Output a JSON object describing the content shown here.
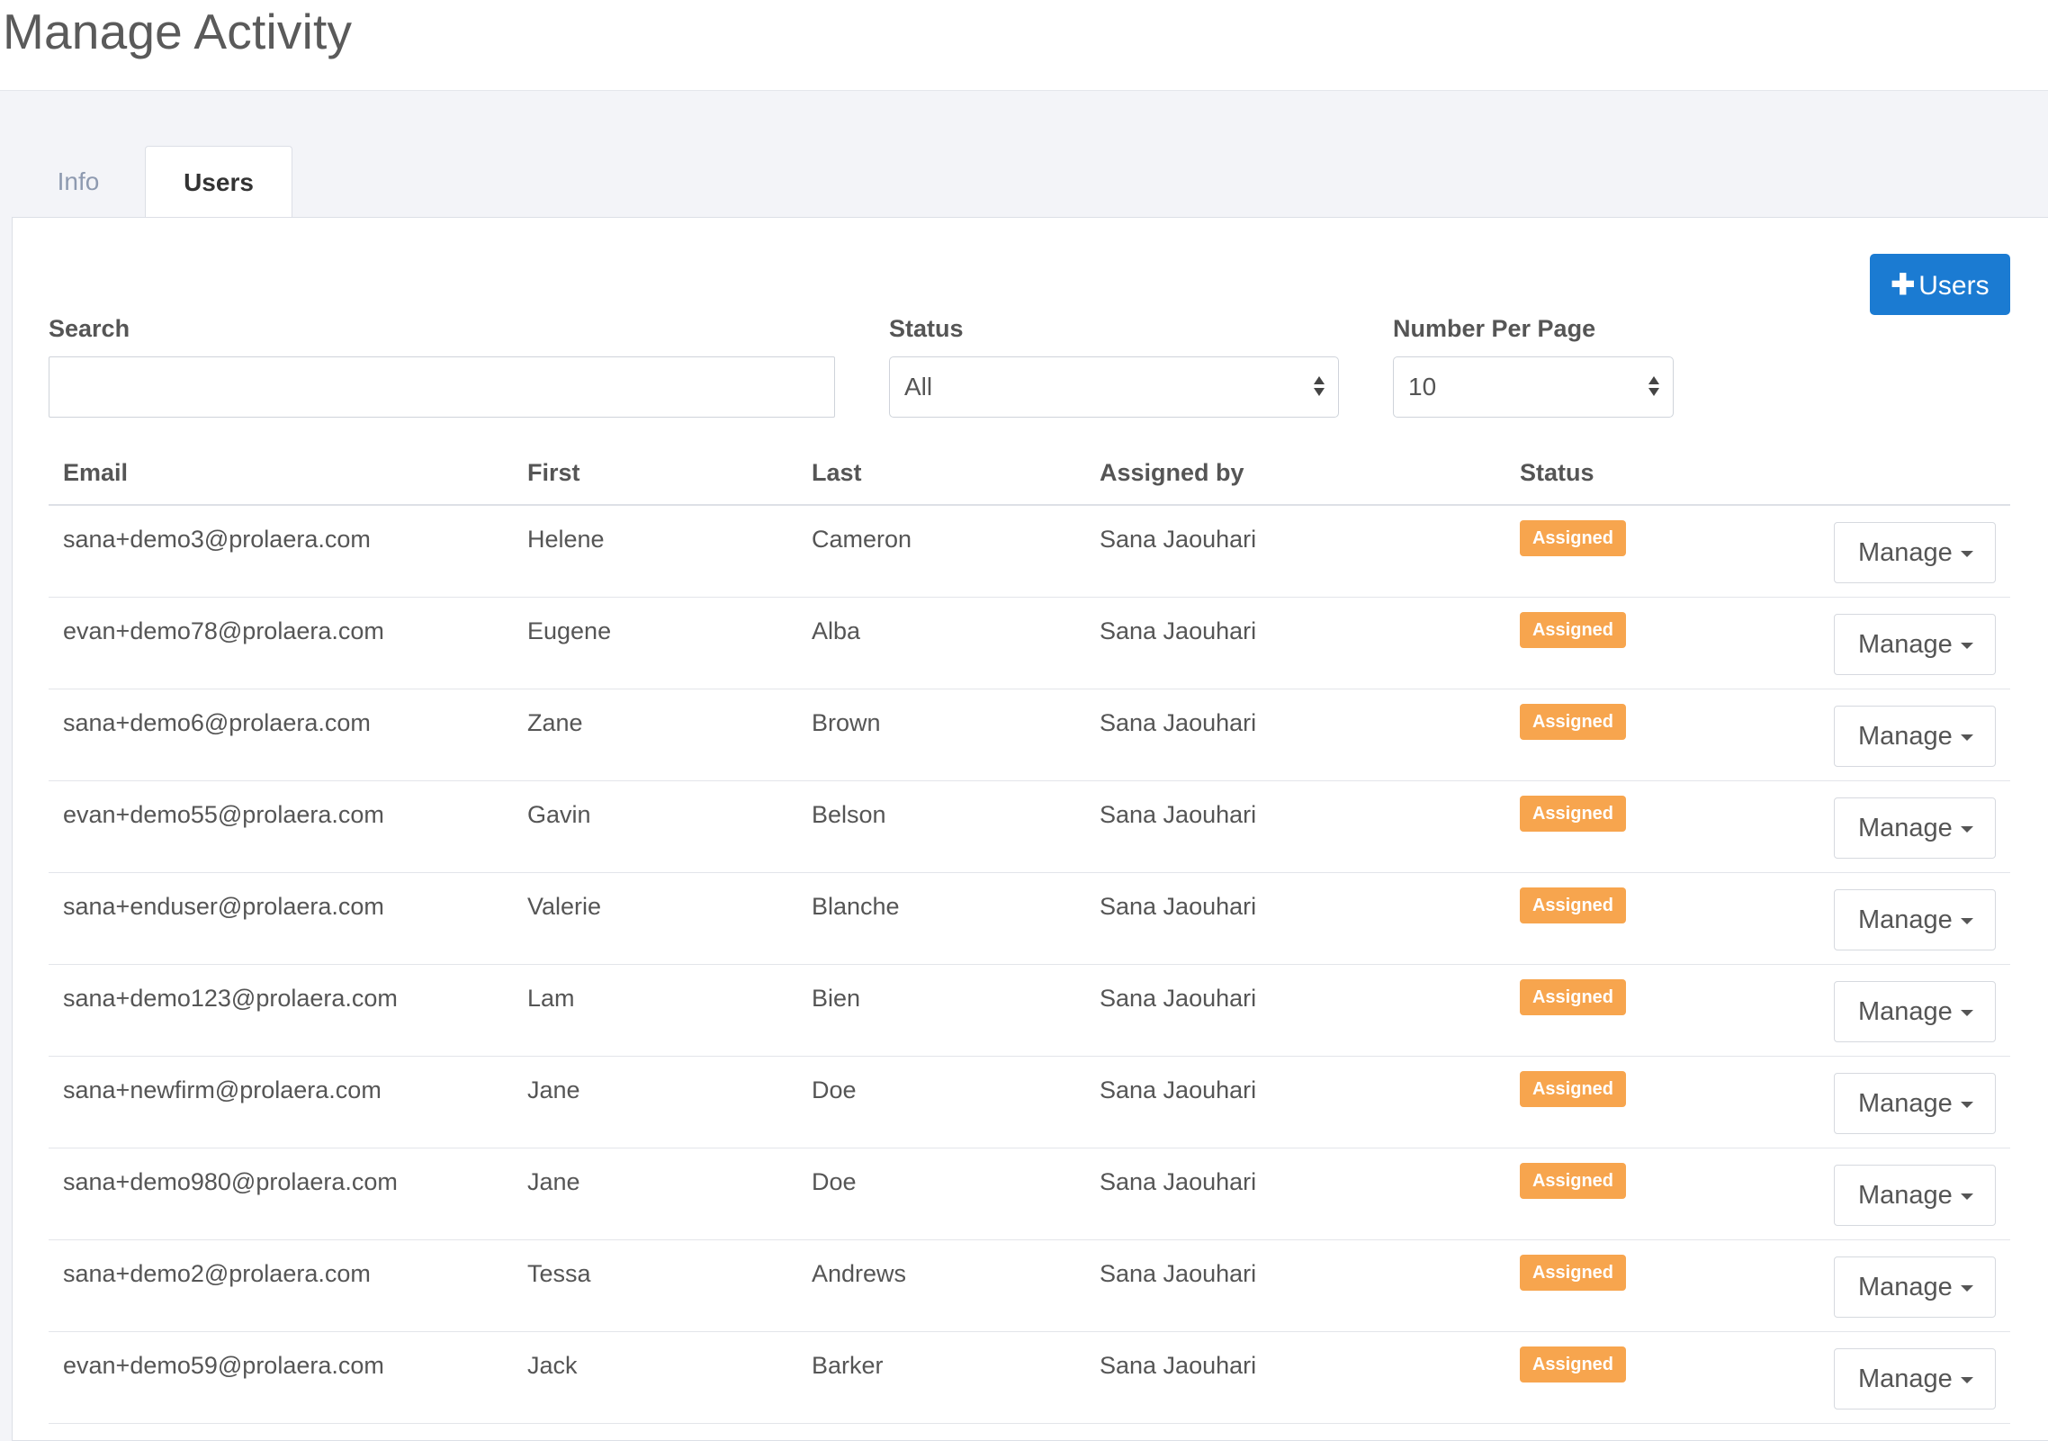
{
  "page": {
    "title": "Manage Activity"
  },
  "tabs": [
    {
      "label": "Info",
      "active": false
    },
    {
      "label": "Users",
      "active": true
    }
  ],
  "toolbar": {
    "add_users_label": "Users",
    "add_users_icon": "plus-icon",
    "accent_color": "#1b7bd2"
  },
  "filters": {
    "search_label": "Search",
    "search_value": "",
    "status_label": "Status",
    "status_value": "All",
    "per_page_label": "Number Per Page",
    "per_page_value": "10"
  },
  "table": {
    "headers": {
      "email": "Email",
      "first": "First",
      "last": "Last",
      "assigned_by": "Assigned by",
      "status": "Status"
    },
    "badge_color": "#f7a54e",
    "rows": [
      {
        "email": "sana+demo3@prolaera.com",
        "first": "Helene",
        "last": "Cameron",
        "assigned_by": "Sana Jaouhari",
        "status": "Assigned",
        "action": "Manage"
      },
      {
        "email": "evan+demo78@prolaera.com",
        "first": "Eugene",
        "last": "Alba",
        "assigned_by": "Sana Jaouhari",
        "status": "Assigned",
        "action": "Manage"
      },
      {
        "email": "sana+demo6@prolaera.com",
        "first": "Zane",
        "last": "Brown",
        "assigned_by": "Sana Jaouhari",
        "status": "Assigned",
        "action": "Manage"
      },
      {
        "email": "evan+demo55@prolaera.com",
        "first": "Gavin",
        "last": "Belson",
        "assigned_by": "Sana Jaouhari",
        "status": "Assigned",
        "action": "Manage"
      },
      {
        "email": "sana+enduser@prolaera.com",
        "first": "Valerie",
        "last": "Blanche",
        "assigned_by": "Sana Jaouhari",
        "status": "Assigned",
        "action": "Manage"
      },
      {
        "email": "sana+demo123@prolaera.com",
        "first": "Lam",
        "last": "Bien",
        "assigned_by": "Sana Jaouhari",
        "status": "Assigned",
        "action": "Manage"
      },
      {
        "email": "sana+newfirm@prolaera.com",
        "first": "Jane",
        "last": "Doe",
        "assigned_by": "Sana Jaouhari",
        "status": "Assigned",
        "action": "Manage"
      },
      {
        "email": "sana+demo980@prolaera.com",
        "first": "Jane",
        "last": "Doe",
        "assigned_by": "Sana Jaouhari",
        "status": "Assigned",
        "action": "Manage"
      },
      {
        "email": "sana+demo2@prolaera.com",
        "first": "Tessa",
        "last": "Andrews",
        "assigned_by": "Sana Jaouhari",
        "status": "Assigned",
        "action": "Manage"
      },
      {
        "email": "evan+demo59@prolaera.com",
        "first": "Jack",
        "last": "Barker",
        "assigned_by": "Sana Jaouhari",
        "status": "Assigned",
        "action": "Manage"
      }
    ]
  }
}
